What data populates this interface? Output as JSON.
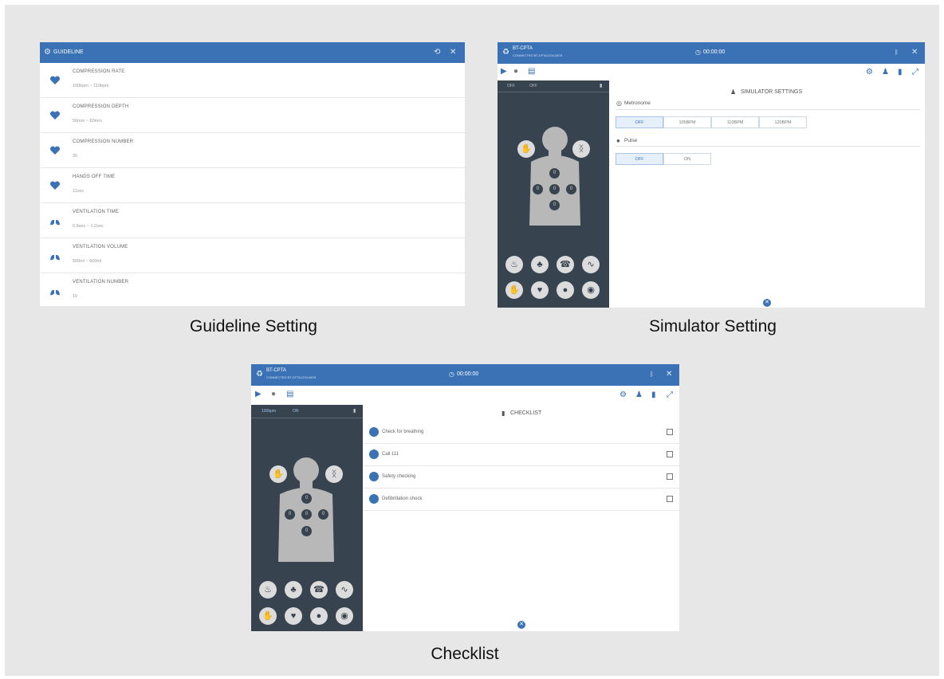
{
  "captions": {
    "guideline": "Guideline Setting",
    "simulator": "Simulator Setting",
    "checklist": "Checklist"
  },
  "guideline": {
    "title": "GUIDELINE",
    "items": [
      {
        "icon": "heart-icon",
        "title": "COMPRESSION RATE",
        "value": "100bpm ~ 110bpm"
      },
      {
        "icon": "heart-icon",
        "title": "COMPRESSION DEPTH",
        "value": "50mm ~ 60mm"
      },
      {
        "icon": "heart-icon",
        "title": "COMPRESSION NUMBER",
        "value": "30"
      },
      {
        "icon": "heart-icon",
        "title": "HANDS OFF TIME",
        "value": "11sec"
      },
      {
        "icon": "lungs-icon",
        "title": "VENTILATION TIME",
        "value": "0.8sec ~ 1.2sec"
      },
      {
        "icon": "lungs-icon",
        "title": "VENTILATION VOLUME",
        "value": "500ml ~ 600ml"
      },
      {
        "icon": "lungs-icon",
        "title": "VENTILATION NUMBER",
        "value": "10"
      }
    ]
  },
  "simulator": {
    "app_name": "BT-CPTA",
    "app_sub": "CONNECTED BT-CPTA1234-5678",
    "timer": "00:00:00",
    "status_left": "OFF",
    "status_right": "OFF",
    "settings_title": "SIMULATOR SETTINGS",
    "metronome_label": "Metronome",
    "metronome_options": [
      "OFF",
      "105BPM",
      "110BPM",
      "120BPM"
    ],
    "pulse_label": "Pulse",
    "pulse_options": [
      "OFF",
      "ON"
    ]
  },
  "checklist": {
    "app_name": "BT-CPTA",
    "app_sub": "CONNECTED BT-CPTA1234-5678",
    "timer": "00:00:00",
    "status_left": "100bpm",
    "status_right": "ON",
    "title": "CHECKLIST",
    "items": [
      {
        "label": "Check for breathing"
      },
      {
        "label": "Call 111"
      },
      {
        "label": "Safety checking"
      },
      {
        "label": "Defibrillation shock"
      }
    ]
  },
  "colors": {
    "accent": "#3a72b5",
    "panel": "#37444f",
    "background": "#e7e7e7"
  }
}
